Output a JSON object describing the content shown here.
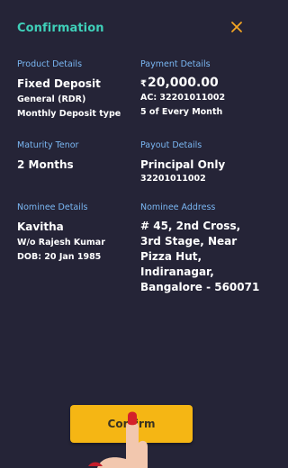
{
  "header": {
    "title": "Confirmation",
    "close_icon": "close-icon"
  },
  "product": {
    "label": "Product Details",
    "name": "Fixed Deposit",
    "category": "General (RDR)",
    "type": "Monthly Deposit type"
  },
  "payment": {
    "label": "Payment Details",
    "currency_symbol": "₹",
    "amount": "20,000.00",
    "account": "AC: 32201011002",
    "schedule": "5 of Every Month"
  },
  "maturity": {
    "label": "Maturity Tenor",
    "value": "2 Months"
  },
  "payout": {
    "label": "Payout Details",
    "value": "Principal Only",
    "account": "32201011002"
  },
  "nominee": {
    "label": "Nominee Details",
    "name": "Kavitha",
    "relation": "W/o Rajesh Kumar",
    "dob": "DOB: 20 Jan 1985"
  },
  "address": {
    "label": "Nominee Address",
    "value": "# 45, 2nd Cross, 3rd Stage, Near Pizza Hut, Indiranagar, Bangalore - 560071"
  },
  "confirm": {
    "label": "Confirm"
  },
  "colors": {
    "background": "#252437",
    "accent_teal": "#3fd0b9",
    "label_blue": "#7ab7f3",
    "close_orange": "#f5a623",
    "button_yellow": "#f5b614"
  }
}
